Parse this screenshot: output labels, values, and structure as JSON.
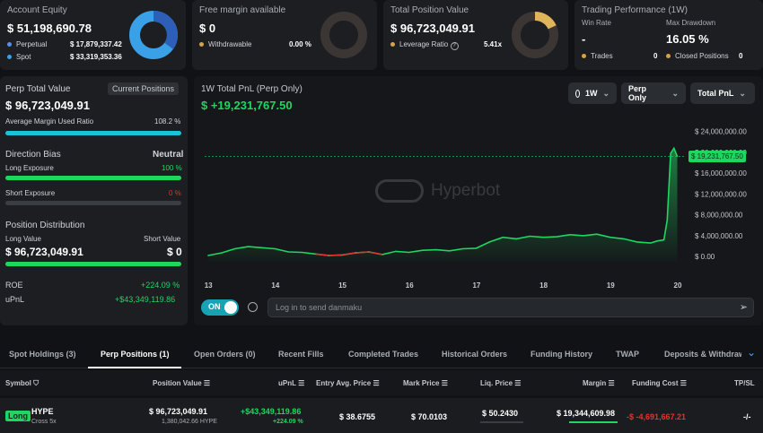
{
  "equity": {
    "title": "Account Equity",
    "value": "$ 51,198,690.78",
    "perp_label": "Perpetual",
    "perp_value": "$ 17,879,337.42",
    "spot_label": "Spot",
    "spot_value": "$ 33,319,353.36",
    "perp_color": "#5b8ee6",
    "spot_color": "#3aa0e8",
    "perp_fraction": 0.35
  },
  "margin": {
    "title": "Free margin available",
    "value": "$ 0",
    "withdrawable_label": "Withdrawable",
    "withdrawable_value": "0.00 %"
  },
  "position": {
    "title": "Total Position Value",
    "value": "$ 96,723,049.91",
    "leverage_label": "Leverage Ratio",
    "leverage_value": "5.41x",
    "donut_fraction": 0.18
  },
  "performance": {
    "title": "Trading Performance (1W)",
    "win_rate_label": "Win Rate",
    "win_rate_value": "-",
    "max_dd_label": "Max Drawdown",
    "max_dd_value": "16.05 %",
    "trades_label": "Trades",
    "trades_value": "0",
    "closed_label": "Closed Positions",
    "closed_value": "0"
  },
  "left": {
    "perp_total_label": "Perp Total Value",
    "current_positions_btn": "Current Positions",
    "perp_total_value": "$ 96,723,049.91",
    "avg_margin_label": "Average Margin Used Ratio",
    "avg_margin_value": "108.2 %",
    "avg_margin_fraction": 1.0,
    "direction_label": "Direction Bias",
    "direction_value": "Neutral",
    "long_exp_label": "Long Exposure",
    "long_exp_value": "100 %",
    "long_exp_fraction": 1.0,
    "short_exp_label": "Short Exposure",
    "short_exp_value": "0 %",
    "short_exp_fraction": 0,
    "distribution_label": "Position Distribution",
    "long_value_label": "Long Value",
    "short_value_label": "Short Value",
    "long_value": "$ 96,723,049.91",
    "short_value": "$ 0",
    "long_fraction": 1.0,
    "roe_label": "ROE",
    "roe_value": "+224.09 %",
    "upnl_label": "uPnL",
    "upnl_value": "+$43,349,119.86"
  },
  "chart": {
    "title": "1W Total PnL (Perp Only)",
    "value": "$ +19,231,767.50",
    "period_btn": "1W",
    "filter_btn": "Perp Only",
    "metric_btn": "Total PnL",
    "watermark": "Hyperbot",
    "current_label": "$ 19,231,767.50",
    "on_label": "ON",
    "danmaku_placeholder": "Log in to send danmaku"
  },
  "chart_data": {
    "type": "area",
    "title": "1W Total PnL (Perp Only)",
    "x_ticks": [
      "13",
      "14",
      "15",
      "16",
      "17",
      "18",
      "19",
      "20"
    ],
    "y_ticks": [
      "$ 24,000,000.00",
      "$ 20,000,000.00",
      "$ 16,000,000.00",
      "$ 12,000,000.00",
      "$ 8,000,000.00",
      "$ 4,000,000.00",
      "$ 0.00"
    ],
    "ylim": [
      -1000000,
      25500000
    ],
    "y_tick_values": [
      24000000,
      20000000,
      16000000,
      12000000,
      8000000,
      4000000,
      0
    ],
    "xlim": [
      12.95,
      20.1
    ],
    "x": [
      13.0,
      13.2,
      13.4,
      13.6,
      13.8,
      14.0,
      14.2,
      14.4,
      14.6,
      14.8,
      15.0,
      15.2,
      15.4,
      15.6,
      15.8,
      16.0,
      16.2,
      16.4,
      16.6,
      16.8,
      17.0,
      17.2,
      17.4,
      17.6,
      17.8,
      18.0,
      18.2,
      18.4,
      18.6,
      18.8,
      19.0,
      19.2,
      19.4,
      19.6,
      19.7,
      19.8,
      19.85,
      19.9,
      19.95,
      20.0
    ],
    "y": [
      200000,
      700000,
      1500000,
      1900000,
      1700000,
      1500000,
      900000,
      800000,
      500000,
      200000,
      300000,
      700000,
      900000,
      400000,
      1000000,
      800000,
      1200000,
      1300000,
      1100000,
      1500000,
      1600000,
      2800000,
      3700000,
      3400000,
      3900000,
      3700000,
      3800000,
      4200000,
      4000000,
      4300000,
      3700000,
      3400000,
      2800000,
      2600000,
      3000000,
      3200000,
      7000000,
      19800000,
      20800000,
      19231767.5
    ]
  },
  "tabs": [
    "Spot Holdings (3)",
    "Perp Positions (1)",
    "Open Orders (0)",
    "Recent Fills",
    "Completed Trades",
    "Historical Orders",
    "Funding History",
    "TWAP",
    "Deposits & Withdraw"
  ],
  "table": {
    "headers": [
      "Symbol",
      "Position Value",
      "uPnL",
      "Entry Avg. Price",
      "Mark Price",
      "Liq. Price",
      "Margin",
      "Funding Cost",
      "TP/SL"
    ],
    "row": {
      "side": "Long",
      "symbol": "HYPE",
      "mode": "Cross 5x",
      "position_value": "$ 96,723,049.91",
      "position_qty": "1,380,042.66 HYPE",
      "upnl": "+$43,349,119.86",
      "upnl_pct": "+224.09 %",
      "entry": "$ 38.6755",
      "mark": "$ 70.0103",
      "liq": "$ 50.2430",
      "margin": "$ 19,344,609.98",
      "funding": "-$ -4,691,667.21",
      "tpsl": "-/-"
    }
  }
}
